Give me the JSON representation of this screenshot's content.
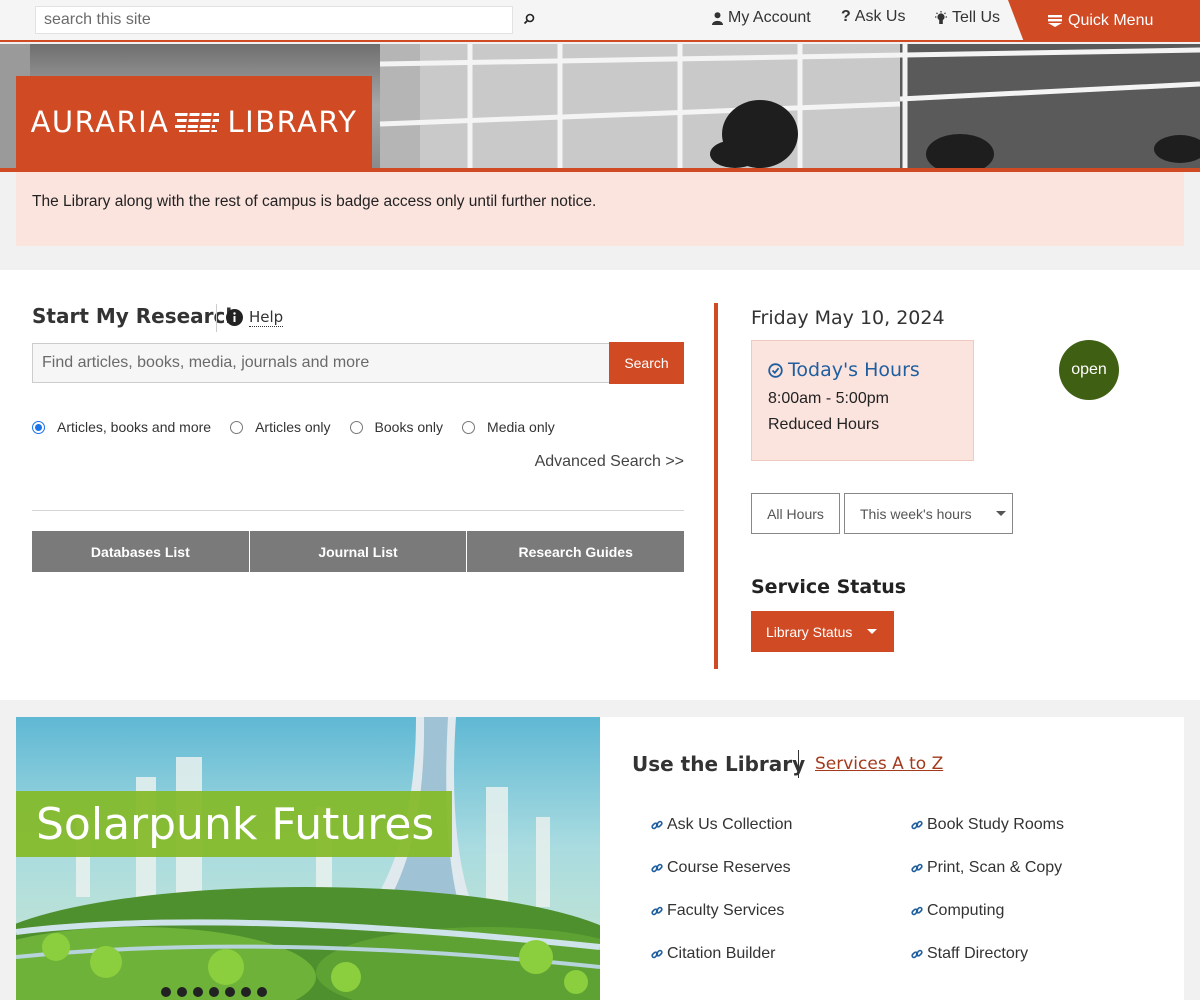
{
  "topbar": {
    "search_placeholder": "search this site",
    "links": [
      {
        "label": "My Account",
        "icon": "user-icon"
      },
      {
        "label": "Ask Us",
        "icon": "question-icon"
      },
      {
        "label": "Tell Us",
        "icon": "lightbulb-icon"
      }
    ],
    "quick_menu_label": "Quick Menu"
  },
  "brand": {
    "logo_left": "AURARIA",
    "logo_right": "LIBRARY",
    "accent_color": "#d04a24"
  },
  "alert": {
    "text": "The Library along with the rest of campus is badge access only until further notice."
  },
  "research": {
    "title": "Start My Research",
    "help_label": "Help",
    "search_placeholder": "Find articles, books, media, journals and more",
    "search_button": "Search",
    "options": [
      {
        "label": "Articles, books and more",
        "selected": true
      },
      {
        "label": "Articles only",
        "selected": false
      },
      {
        "label": "Books only",
        "selected": false
      },
      {
        "label": "Media only",
        "selected": false
      }
    ],
    "advanced_label": "Advanced Search >>",
    "buttons": [
      "Databases List",
      "Journal List",
      "Research Guides"
    ]
  },
  "hours": {
    "date": "Friday May 10, 2024",
    "heading": "Today's Hours",
    "time": "8:00am - 5:00pm",
    "note": "Reduced Hours",
    "status_badge": "open",
    "status_color": "#3f5f13",
    "all_hours_label": "All Hours",
    "week_hours_label": "This week's hours"
  },
  "service": {
    "title": "Service Status",
    "button_label": "Library Status"
  },
  "feature": {
    "title": "Solarpunk Futures"
  },
  "use_library": {
    "title": "Use the Library",
    "services_link": "Services A to Z",
    "links_left": [
      "Ask Us Collection",
      "Course Reserves",
      "Faculty Services",
      "Citation Builder"
    ],
    "links_right": [
      "Book Study Rooms",
      "Print, Scan & Copy",
      "Computing",
      "Staff Directory"
    ]
  }
}
